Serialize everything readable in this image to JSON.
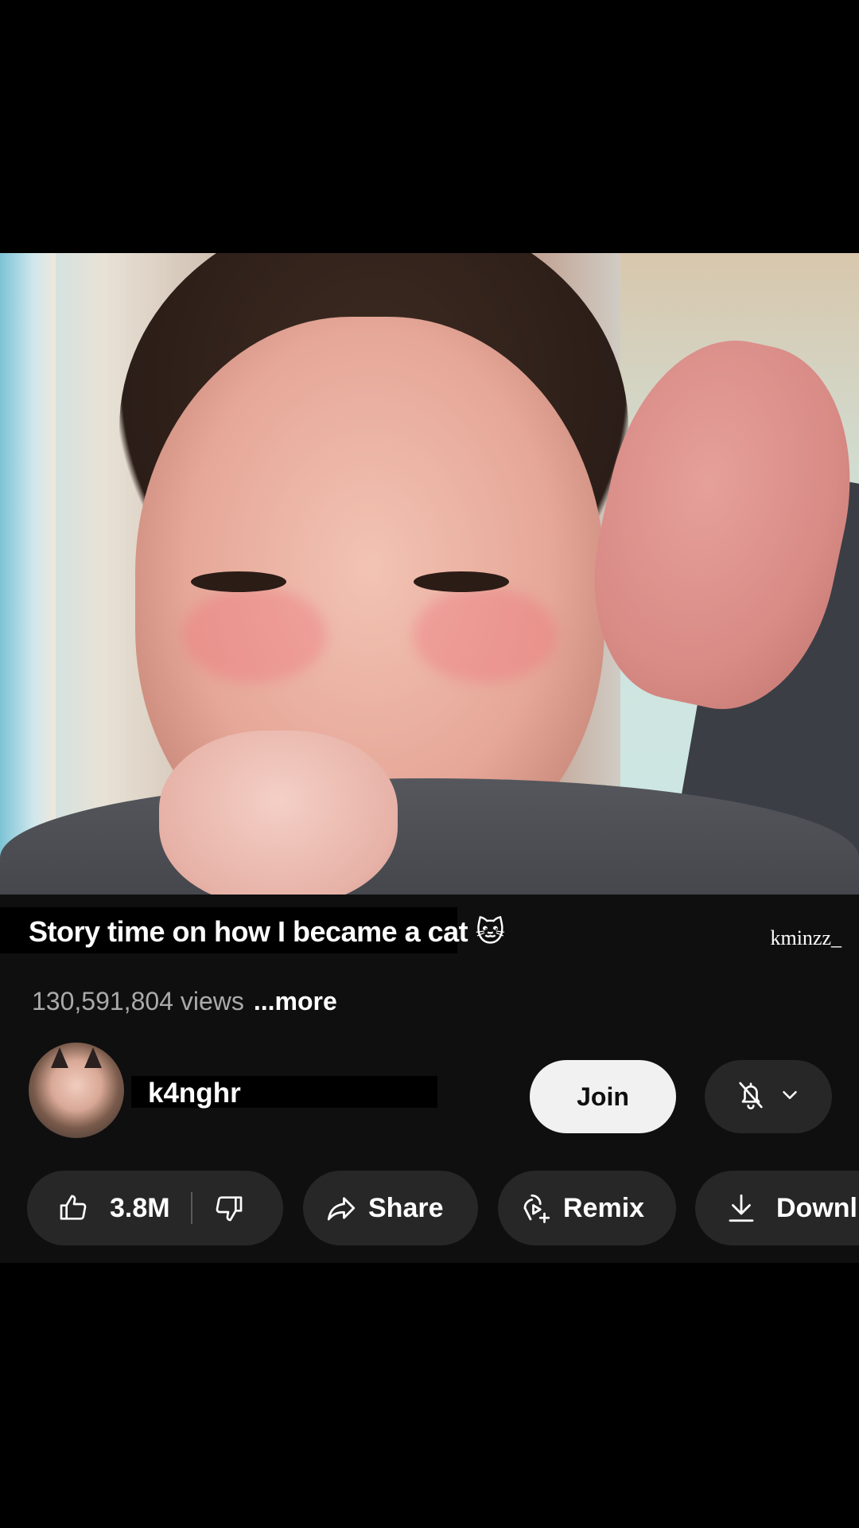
{
  "video": {
    "watermark": "kminzz_"
  },
  "info": {
    "title": "Story time on how I became a cat 🐱",
    "views": "130,591,804 views",
    "more": "...more",
    "watermark": "kminzz_"
  },
  "channel": {
    "name": "k4nghr",
    "join_label": "Join",
    "bell_icon": "bell-off-icon",
    "chevron_icon": "chevron-down-icon"
  },
  "actions": {
    "like_count": "3.8M",
    "share_label": "Share",
    "remix_label": "Remix",
    "download_label": "Downl"
  },
  "colors": {
    "panel_bg": "#0f0f0f",
    "pill_bg": "#272727",
    "join_bg": "#f1f1f1",
    "secondary_text": "#aaaaaa"
  }
}
